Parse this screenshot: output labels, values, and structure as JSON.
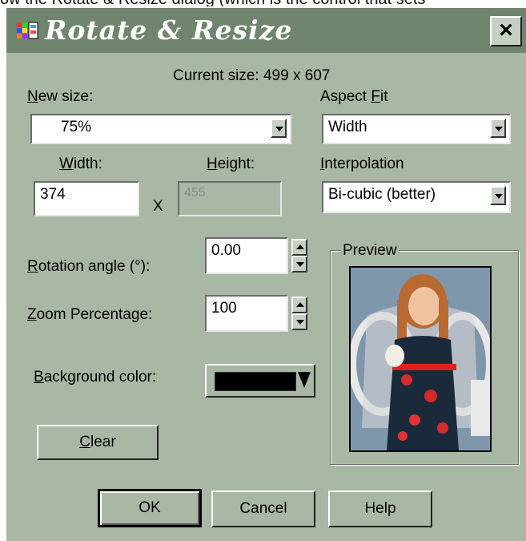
{
  "background_text": "ow the Rotate & Resize dialog (which is the control that sets",
  "dialog": {
    "title": "Rotate & Resize",
    "close_label": "×",
    "colors": {
      "titlebar": "#6f856d",
      "body": "#a9b7a5"
    }
  },
  "current_size": "Current size: 499 x 607",
  "new_size": {
    "label_key": "N",
    "label_rest": "ew size:",
    "value": "75%"
  },
  "aspect_fit": {
    "label_pre": "Aspect ",
    "label_key": "F",
    "label_rest": "it",
    "value": "Width"
  },
  "width": {
    "label_key": "W",
    "label_rest": "idth:",
    "value": "374"
  },
  "times": "X",
  "height": {
    "label_key": "H",
    "label_rest": "eight:",
    "value": "455"
  },
  "interpolation": {
    "label_key": "I",
    "label_rest": "nterpolation",
    "value": "Bi-cubic (better)"
  },
  "rotation": {
    "label_key": "R",
    "label_rest": "otation angle (°):",
    "value": "0.00"
  },
  "zoom": {
    "label_key": "Z",
    "label_rest": "oom Percentage:",
    "value": "100"
  },
  "background_color": {
    "label_key": "B",
    "label_rest": "ackground color:",
    "value": "#000000"
  },
  "preview_label": "Preview",
  "buttons": {
    "clear_key": "C",
    "clear_rest": "lear",
    "ok": "OK",
    "cancel": "Cancel",
    "help": "Help"
  }
}
